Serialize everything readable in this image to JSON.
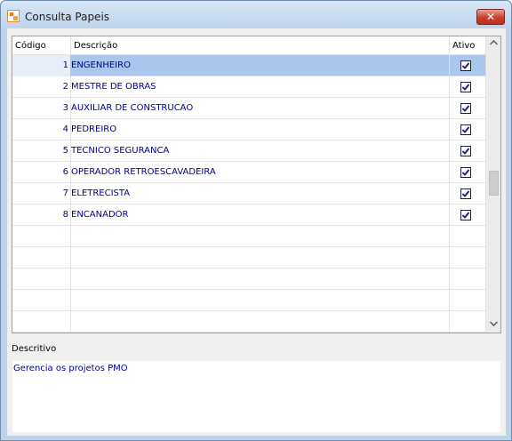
{
  "window": {
    "title": "Consulta Papeis",
    "close_label": "✕"
  },
  "grid": {
    "columns": {
      "codigo": "Código",
      "descricao": "Descrição",
      "ativo": "Ativo"
    },
    "rows": [
      {
        "codigo": "1",
        "descricao": "ENGENHEIRO",
        "ativo": true
      },
      {
        "codigo": "2",
        "descricao": "MESTRE DE OBRAS",
        "ativo": true
      },
      {
        "codigo": "3",
        "descricao": "AUXILIAR DE CONSTRUCAO",
        "ativo": true
      },
      {
        "codigo": "4",
        "descricao": "PEDREIRO",
        "ativo": true
      },
      {
        "codigo": "5",
        "descricao": "TECNICO SEGURANCA",
        "ativo": true
      },
      {
        "codigo": "6",
        "descricao": "OPERADOR RETROESCAVADEIRA",
        "ativo": true
      },
      {
        "codigo": "7",
        "descricao": "ELETRECISTA",
        "ativo": true
      },
      {
        "codigo": "8",
        "descricao": "ENCANADOR",
        "ativo": true
      }
    ],
    "selected_index": 0,
    "empty_rows": 5
  },
  "scrollbar": {
    "up_icon": "chevron-up-icon",
    "down_icon": "chevron-down-icon"
  },
  "descritivo": {
    "label": "Descritivo",
    "value": "Gerencia os projetos PMO"
  },
  "colors": {
    "selection": "#a9c6ec",
    "text_blue": "#00008b",
    "close_red": "#c7402b"
  }
}
